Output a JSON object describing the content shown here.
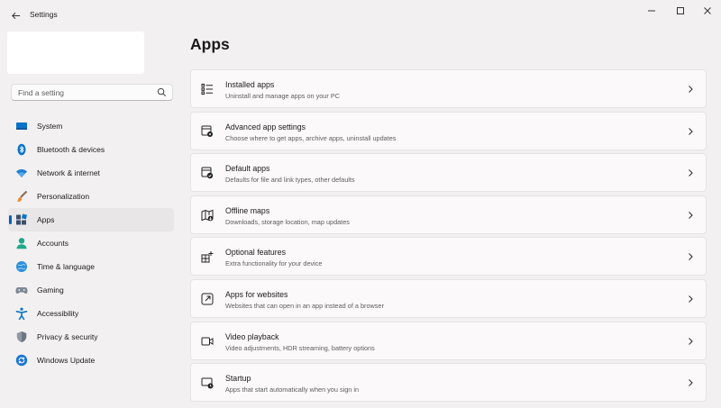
{
  "window": {
    "title": "Settings"
  },
  "search": {
    "placeholder": "Find a setting"
  },
  "nav": {
    "items": [
      {
        "label": "System",
        "icon": "monitor-icon",
        "selected": false
      },
      {
        "label": "Bluetooth & devices",
        "icon": "bluetooth-icon",
        "selected": false
      },
      {
        "label": "Network & internet",
        "icon": "wifi-icon",
        "selected": false
      },
      {
        "label": "Personalization",
        "icon": "brush-icon",
        "selected": false
      },
      {
        "label": "Apps",
        "icon": "apps-icon",
        "selected": true
      },
      {
        "label": "Accounts",
        "icon": "person-icon",
        "selected": false
      },
      {
        "label": "Time & language",
        "icon": "globe-clock-icon",
        "selected": false
      },
      {
        "label": "Gaming",
        "icon": "gamepad-icon",
        "selected": false
      },
      {
        "label": "Accessibility",
        "icon": "accessibility-icon",
        "selected": false
      },
      {
        "label": "Privacy & security",
        "icon": "shield-icon",
        "selected": false
      },
      {
        "label": "Windows Update",
        "icon": "update-icon",
        "selected": false
      }
    ]
  },
  "main": {
    "title": "Apps",
    "cards": [
      {
        "title": "Installed apps",
        "desc": "Uninstall and manage apps on your PC",
        "icon": "list-icon"
      },
      {
        "title": "Advanced app settings",
        "desc": "Choose where to get apps, archive apps, uninstall updates",
        "icon": "app-settings-icon"
      },
      {
        "title": "Default apps",
        "desc": "Defaults for file and link types, other defaults",
        "icon": "default-apps-icon"
      },
      {
        "title": "Offline maps",
        "desc": "Downloads, storage location, map updates",
        "icon": "map-icon"
      },
      {
        "title": "Optional features",
        "desc": "Extra functionality for your device",
        "icon": "features-icon"
      },
      {
        "title": "Apps for websites",
        "desc": "Websites that can open in an app instead of a browser",
        "icon": "open-external-icon"
      },
      {
        "title": "Video playback",
        "desc": "Video adjustments, HDR streaming, battery options",
        "icon": "video-icon"
      },
      {
        "title": "Startup",
        "desc": "Apps that start automatically when you sign in",
        "icon": "startup-icon"
      }
    ]
  },
  "colors": {
    "accent": "#005fb8",
    "background": "#f3f0f1",
    "card": "#fbf9fa"
  }
}
